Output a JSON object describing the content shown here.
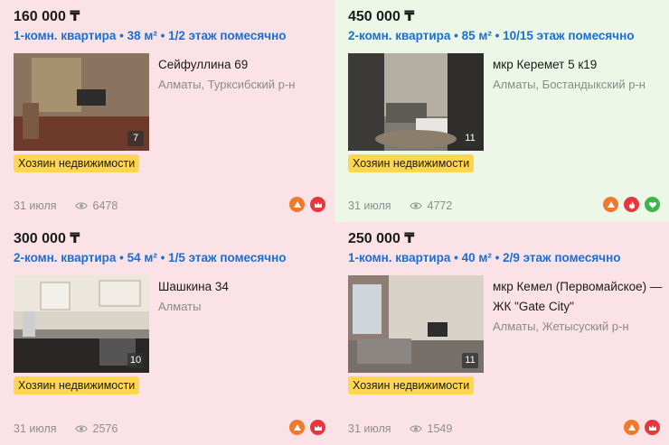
{
  "listings": [
    {
      "price": "160 000 ₸",
      "title": "1-комн. квартира • 38 м² • 1/2 этаж помесячно",
      "address": "Сейфуллина 69",
      "location": "Алматы, Турксибский р-н",
      "photo_count": "7",
      "badge": "Хозяин недвижимости",
      "date": "31 июля",
      "views": "6478",
      "icons": [
        "up-icon",
        "crown-icon"
      ]
    },
    {
      "price": "450 000 ₸",
      "title": "2-комн. квартира • 85 м² • 10/15 этаж помесячно",
      "address": "мкр Керемет 5 к19",
      "location": "Алматы, Бостандыкский р-н",
      "photo_count": "11",
      "badge": "Хозяин недвижимости",
      "date": "31 июля",
      "views": "4772",
      "icons": [
        "up-icon",
        "fire-icon",
        "heart-icon"
      ]
    },
    {
      "price": "300 000 ₸",
      "title": "2-комн. квартира • 54 м² • 1/5 этаж помесячно",
      "address": "Шашкина 34",
      "location": "Алматы",
      "photo_count": "10",
      "badge": "Хозяин недвижимости",
      "date": "31 июля",
      "views": "2576",
      "icons": [
        "up-icon",
        "crown-icon"
      ]
    },
    {
      "price": "250 000 ₸",
      "title": "1-комн. квартира • 40 м² • 2/9 этаж помесячно",
      "address": "мкр Кемел (Первомайское) — ЖК \"Gate City\"",
      "location": "Алматы, Жетысуский р-н",
      "photo_count": "11",
      "badge": "Хозяин недвижимости",
      "date": "31 июля",
      "views": "1549",
      "icons": [
        "up-icon",
        "crown-icon"
      ]
    }
  ],
  "colors": {
    "card_pink": "#fbe2e7",
    "card_green": "#ecf7e8",
    "title_blue": "#1a6fd6",
    "badge_yellow": "#ffd64d",
    "up_orange": "#f07a2a",
    "crown_red": "#e8363d",
    "fire_red": "#e8363d",
    "heart_green": "#3cb54a"
  }
}
